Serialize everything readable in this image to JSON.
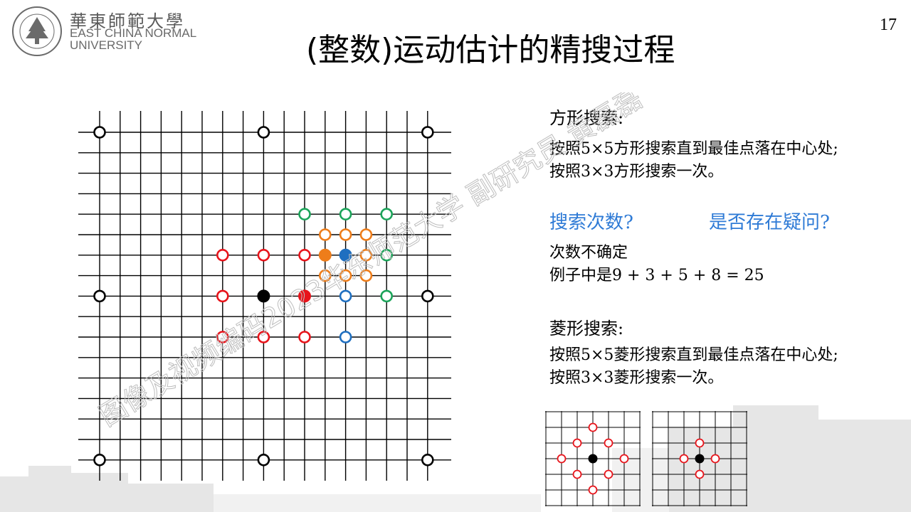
{
  "header": {
    "logo_cn": "華東師範大學",
    "logo_en_line1": "EAST CHINA NORMAL",
    "logo_en_line2": "UNIVERSITY",
    "seal_text": "EAST CHINA NORMAL UNIVERSITY",
    "page_number": "17",
    "title": "(整数)运动估计的精搜过程"
  },
  "square_search": {
    "heading": "方形搜索:",
    "line1": "按照5×5方形搜索直到最佳点落在中心处;",
    "line2": "按照3×3方形搜索一次。"
  },
  "questions": {
    "q1": "搜索次数?",
    "q2": "是否存在疑问?"
  },
  "answer": {
    "line1": "次数不确定",
    "line2": "例子中是9 + 3 + 5 + 8 = 25"
  },
  "diamond_search": {
    "heading": "菱形搜索:",
    "line1": "按照5×5菱形搜索直到最佳点落在中心处;",
    "line2": "按照3×3菱形搜索一次。"
  },
  "watermark": {
    "line1": "图像及视频编码2023华东师范大学 副研究员 黄磊磊"
  },
  "colors": {
    "black": "#000000",
    "red": "#e8141b",
    "blue": "#1f6fc0",
    "orange": "#ee7d1a",
    "green": "#1ca45a",
    "accent_text": "#2f7bd6"
  }
}
